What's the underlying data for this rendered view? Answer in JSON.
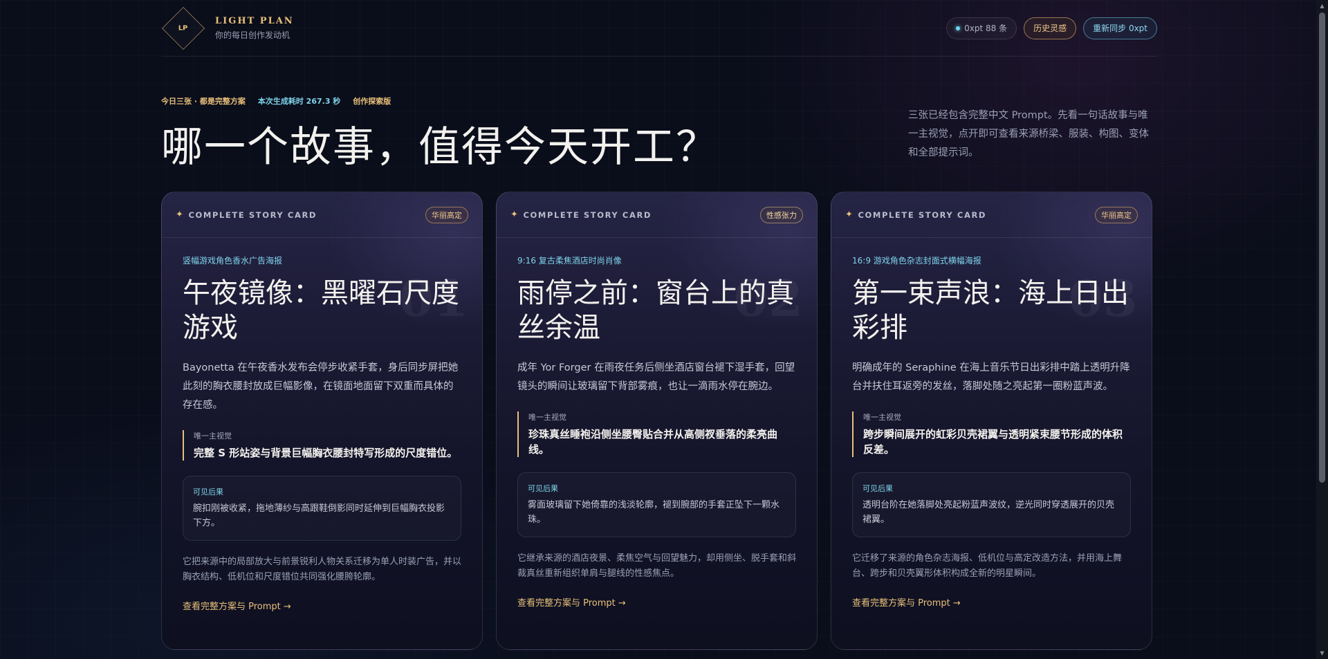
{
  "brand": {
    "logo": "LP",
    "title": "LIGHT PLAN",
    "subtitle": "你的每日创作发动机"
  },
  "top_actions": {
    "status": "0xpt 88 条",
    "history": "历史灵感",
    "resync": "重新同步 0xpt"
  },
  "hero": {
    "tags": [
      "今日三张 · 都是完整方案",
      "本次生成耗时 267.3 秒",
      "创作探索版"
    ],
    "title": "哪一个故事，值得今天开工？",
    "desc": "三张已经包含完整中文 Prompt。先看一句话故事与唯一主视觉，点开即可查看来源桥梁、服装、构图、变体和全部提示词。"
  },
  "cards": [
    {
      "kicker": "COMPLETE STORY CARD",
      "badge": "华丽高定",
      "num": "01",
      "category": "竖幅游戏角色香水广告海报",
      "title": "午夜镜像：黑曜石尺度游戏",
      "story": "Bayonetta 在午夜香水发布会停步收紧手套，身后同步屏把她此刻的胸衣腰封放成巨幅影像，在镜面地面留下双重而具体的存在感。",
      "vision_label": "唯一主视觉",
      "vision": "完整 S 形站姿与背景巨幅胸衣腰封特写形成的尺度错位。",
      "result_label": "可见后果",
      "result": "腕扣刚被收紧，拖地薄纱与高跟鞋倒影同时延伸到巨幅胸衣投影下方。",
      "note": "它把来源中的局部放大与前景锐利人物关系迁移为单人时装广告，并以胸衣结构、低机位和尺度错位共同强化腰胯轮廓。",
      "cta": "查看完整方案与 Prompt →"
    },
    {
      "kicker": "COMPLETE STORY CARD",
      "badge": "性感张力",
      "num": "02",
      "category": "9:16 复古柔焦酒店时尚肖像",
      "title": "雨停之前：窗台上的真丝余温",
      "story": "成年 Yor Forger 在雨夜任务后侧坐酒店窗台褪下湿手套，回望镜头的瞬间让玻璃留下背部雾痕，也让一滴雨水停在腕边。",
      "vision_label": "唯一主视觉",
      "vision": "珍珠真丝睡袍沿侧坐腰臀贴合并从高侧衩垂落的柔亮曲线。",
      "result_label": "可见后果",
      "result": "雾面玻璃留下她倚靠的浅淡轮廓，褪到腕部的手套正坠下一颗水珠。",
      "note": "它继承来源的酒店夜景、柔焦空气与回望魅力，却用侧坐、脱手套和斜裁真丝重新组织单肩与腿线的性感焦点。",
      "cta": "查看完整方案与 Prompt →"
    },
    {
      "kicker": "COMPLETE STORY CARD",
      "badge": "华丽高定",
      "num": "03",
      "category": "16:9 游戏角色杂志封面式横幅海报",
      "title": "第一束声浪：海上日出彩排",
      "story": "明确成年的 Seraphine 在海上音乐节日出彩排中踏上透明升降台并扶住耳返旁的发丝，落脚处随之亮起第一圈粉蓝声波。",
      "vision_label": "唯一主视觉",
      "vision": "跨步瞬间展开的虹彩贝壳裙翼与透明紧束腰节形成的体积反差。",
      "result_label": "可见后果",
      "result": "透明台阶在她落脚处亮起粉蓝声波纹，逆光同时穿透展开的贝壳裙翼。",
      "note": "它迁移了来源的角色杂志海报、低机位与高定改造方法，并用海上舞台、跨步和贝壳翼形体积构成全新的明星瞬间。",
      "cta": "查看完整方案与 Prompt →"
    }
  ],
  "icons": {
    "spark": "✦",
    "status_dot": "status-dot-icon"
  },
  "colors": {
    "gold": "#e8c07a",
    "cyan": "#7fd4ec",
    "background": "#0a0d1a"
  }
}
